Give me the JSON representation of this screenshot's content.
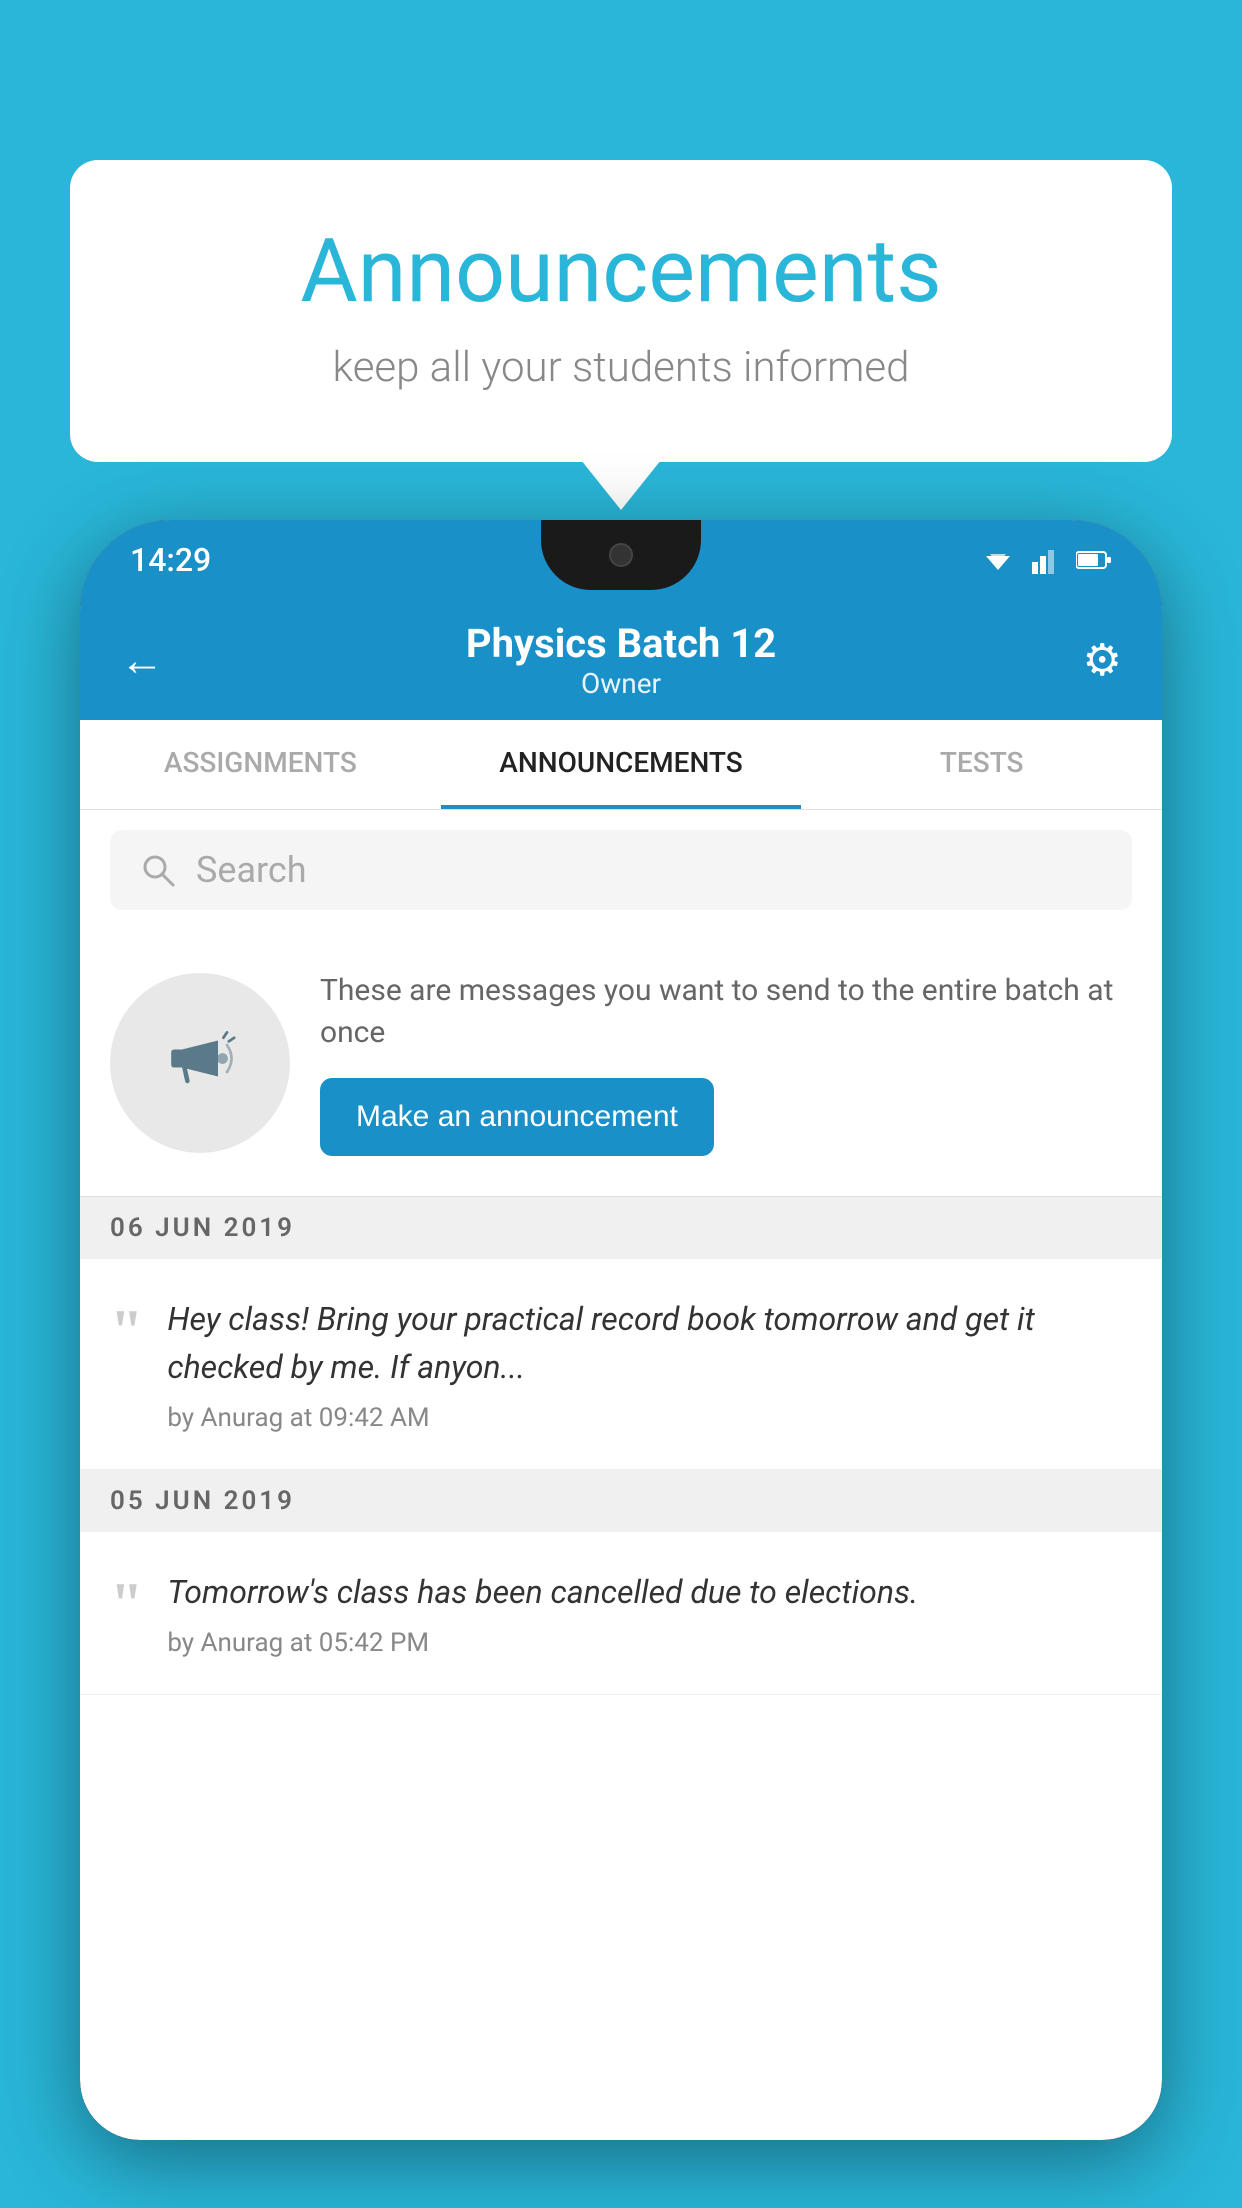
{
  "page": {
    "background_color": "#29b6d8"
  },
  "speech_bubble": {
    "title": "Announcements",
    "subtitle": "keep all your students informed"
  },
  "status_bar": {
    "time": "14:29"
  },
  "app_header": {
    "title": "Physics Batch 12",
    "subtitle": "Owner",
    "back_label": "←",
    "settings_label": "⚙"
  },
  "tabs": [
    {
      "label": "ASSIGNMENTS",
      "active": false
    },
    {
      "label": "ANNOUNCEMENTS",
      "active": true
    },
    {
      "label": "TESTS",
      "active": false
    },
    {
      "label": "...",
      "active": false
    }
  ],
  "search": {
    "placeholder": "Search"
  },
  "promo": {
    "description": "These are messages you want to send to the entire batch at once",
    "button_label": "Make an announcement"
  },
  "announcements": [
    {
      "date": "06  JUN  2019",
      "text": "Hey class! Bring your practical record book tomorrow and get it checked by me. If anyon...",
      "author": "by Anurag at 09:42 AM"
    },
    {
      "date": "05  JUN  2019",
      "text": "Tomorrow's class has been cancelled due to elections.",
      "author": "by Anurag at 05:42 PM"
    }
  ]
}
